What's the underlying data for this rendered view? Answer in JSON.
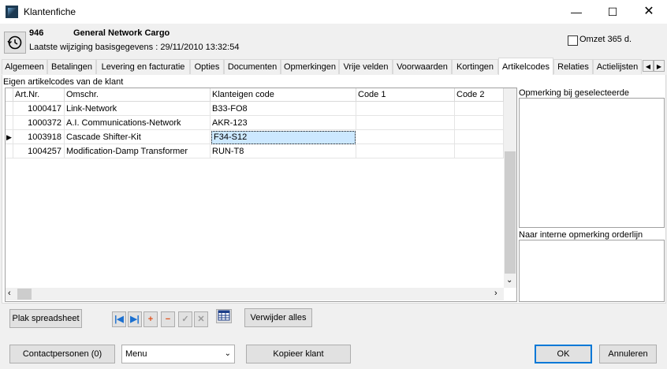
{
  "window": {
    "title": "Klantenfiche"
  },
  "customer": {
    "id": "946",
    "name": "General Network Cargo",
    "last_modified_label": "Laatste wijziging basisgegevens  :",
    "last_modified_value": "29/11/2010 13:32:54"
  },
  "omzet": {
    "label": "Omzet 365 d.",
    "checked": false
  },
  "tabs": [
    {
      "label": "Algemeen"
    },
    {
      "label": "Betalingen"
    },
    {
      "label": "Levering en facturatie"
    },
    {
      "label": "Opties"
    },
    {
      "label": "Documenten"
    },
    {
      "label": "Opmerkingen"
    },
    {
      "label": "Vrije velden"
    },
    {
      "label": "Voorwaarden"
    },
    {
      "label": "Kortingen"
    },
    {
      "label": "Artikelcodes",
      "active": true
    },
    {
      "label": "Relaties"
    },
    {
      "label": "Actielijsten"
    }
  ],
  "section": {
    "label": "Eigen artikelcodes van de klant"
  },
  "grid": {
    "columns": [
      "Art.Nr.",
      "Omschr.",
      "Klanteigen code",
      "Code 1",
      "Code 2"
    ],
    "rows": [
      {
        "artnr": "1000417",
        "omschr": "Link-Network",
        "code": "B33-FO8",
        "code1": "",
        "code2": ""
      },
      {
        "artnr": "1000372",
        "omschr": "A.I. Communications-Network",
        "code": "AKR-123",
        "code1": "",
        "code2": ""
      },
      {
        "artnr": "1003918",
        "omschr": "Cascade Shifter-Kit",
        "code": "F34-S12",
        "code1": "",
        "code2": "",
        "current": true
      },
      {
        "artnr": "1004257",
        "omschr": "Modification-Damp Transformer",
        "code": "RUN-T8",
        "code1": "",
        "code2": ""
      }
    ]
  },
  "side": {
    "remark_selected_label": "Opmerking bij geselecteerde",
    "internal_remark_label": "Naar interne opmerking orderlijn"
  },
  "toolbar": {
    "paste_label": "Plak spreadsheet",
    "delete_all_label": "Verwijder alles"
  },
  "footer": {
    "contacts_label": "Contactpersonen (0)",
    "menu_value": "Menu",
    "copy_label": "Kopieer klant",
    "ok_label": "OK",
    "cancel_label": "Annuleren"
  },
  "icons": {
    "first": "first-record-icon",
    "last": "last-record-icon",
    "add": "plus-icon",
    "remove": "minus-icon",
    "confirm": "checkmark-icon",
    "cancel": "cross-icon",
    "grid": "table-icon"
  }
}
